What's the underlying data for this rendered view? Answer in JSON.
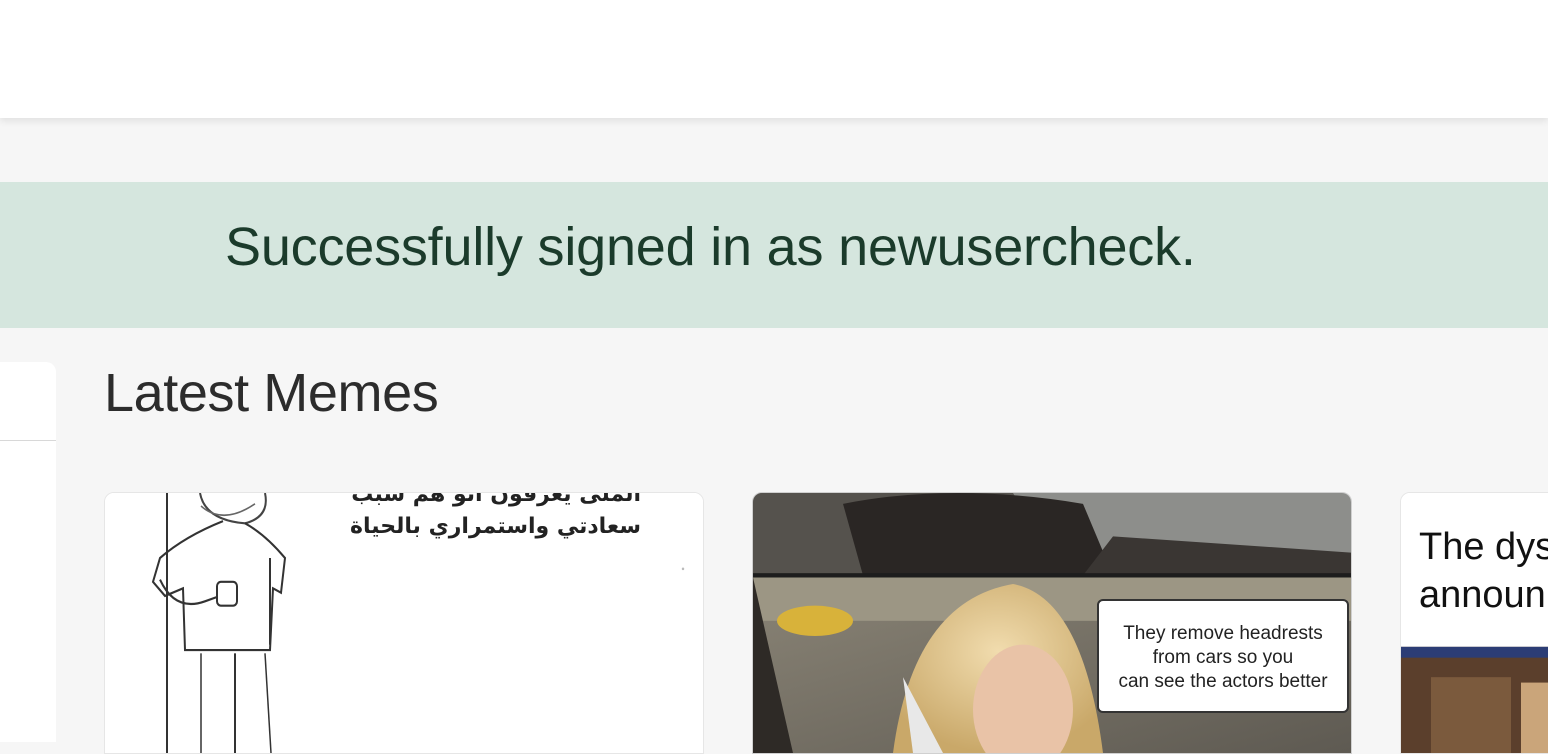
{
  "flash": {
    "message": "Successfully signed in as newusercheck."
  },
  "main": {
    "section_title": "Latest Memes",
    "memes": [
      {
        "caption_lines": [
          "الملى يعرفون انو هم سبب",
          "سعادتي واستمراري بالحياة"
        ]
      },
      {
        "bubble_lines": [
          "They remove headrests",
          "from cars so you",
          "can see the actors better"
        ]
      },
      {
        "text_lines": [
          "The dys",
          "announ"
        ]
      }
    ]
  },
  "colors": {
    "flash_background": "#d5e6de",
    "flash_text": "#1b3b2b",
    "page_background": "#f6f6f6"
  }
}
